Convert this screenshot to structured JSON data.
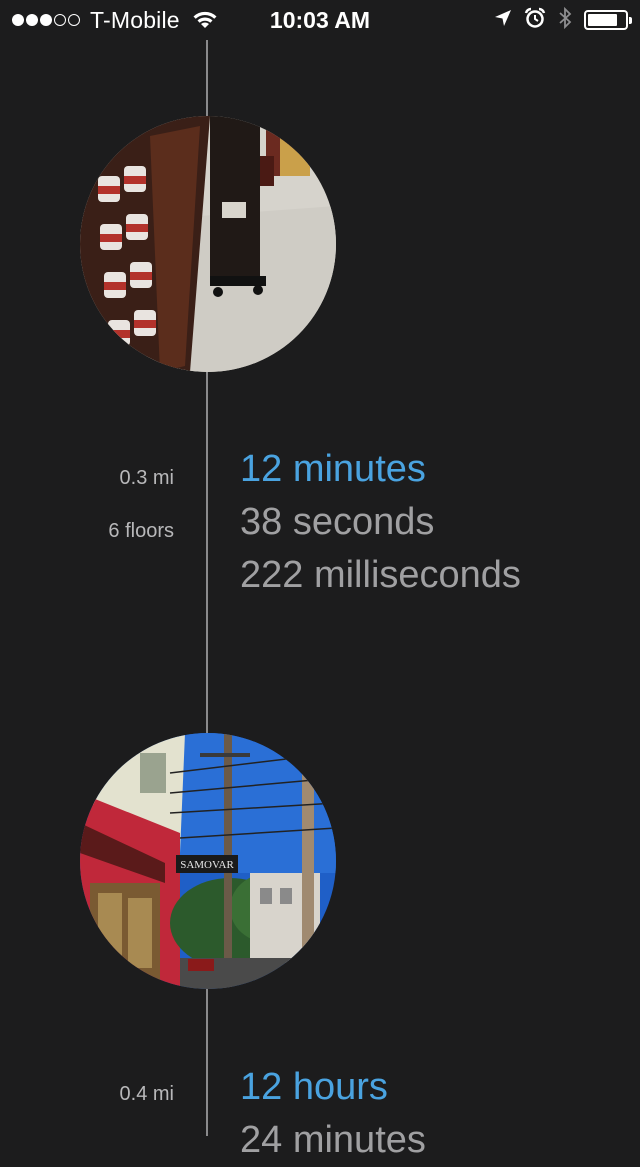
{
  "status_bar": {
    "carrier": "T-Mobile",
    "signal_bars": 3,
    "signal_total": 5,
    "time": "10:03 AM",
    "battery_level": 0.8,
    "icons": [
      "wifi-icon",
      "location-arrow-icon",
      "alarm-icon",
      "bluetooth-icon",
      "battery-icon"
    ]
  },
  "timeline": {
    "entries": [
      {
        "photo": "store-aisle-photo",
        "distance": "0.3 mi",
        "floors": "6 floors",
        "duration": [
          "12 minutes",
          "38 seconds",
          "222 milliseconds"
        ]
      },
      {
        "photo": "samovar-street-photo",
        "sign_text": "SAMOVAR",
        "distance": "0.4 mi",
        "duration": [
          "12 hours",
          "24 minutes"
        ]
      }
    ]
  },
  "colors": {
    "background": "#1c1c1d",
    "accent": "#4aa3e0",
    "secondary_text": "#a0a0a2",
    "timeline_line": "#8a8a8c"
  }
}
